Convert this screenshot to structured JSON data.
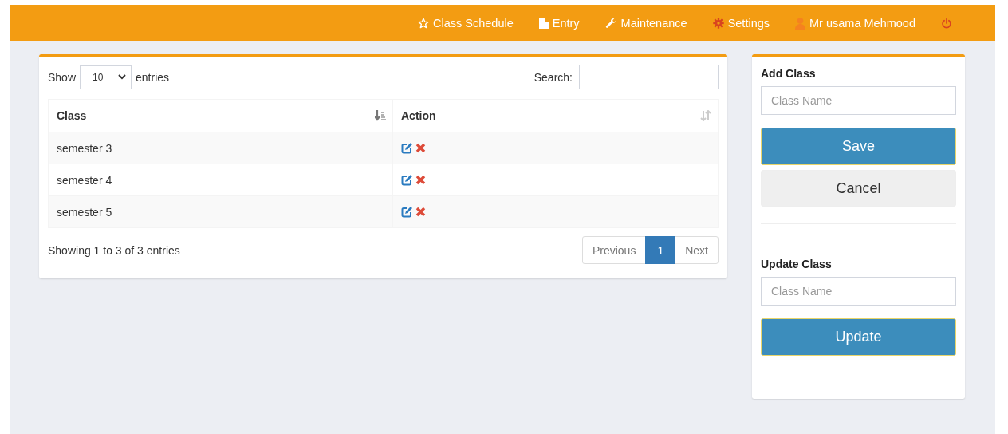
{
  "navbar": {
    "items": [
      {
        "kind": "star",
        "label": "Class Schedule"
      },
      {
        "kind": "file",
        "label": "Entry"
      },
      {
        "kind": "wrench",
        "label": "Maintenance"
      },
      {
        "kind": "gear",
        "label": "Settings"
      },
      {
        "kind": "user",
        "label": "Mr usama Mehmood"
      },
      {
        "kind": "power"
      }
    ]
  },
  "table_card": {
    "length_label_before": "Show",
    "length_value": "10",
    "length_label_after": "entries",
    "search_label": "Search:",
    "columns": [
      {
        "label": "Class",
        "sorted": true
      },
      {
        "label": "Action",
        "sorted": false
      }
    ],
    "rows": [
      {
        "class": "semester 3"
      },
      {
        "class": "semester 4"
      },
      {
        "class": "semester 5"
      }
    ],
    "info": "Showing 1 to 3 of 3 entries",
    "pagination": {
      "previous": "Previous",
      "pages": [
        {
          "label": "1",
          "selected": true
        }
      ],
      "next": "Next"
    }
  },
  "add_class": {
    "title": "Add Class",
    "placeholder": "Class Name",
    "save": "Save",
    "cancel": "Cancel"
  },
  "update_class": {
    "title": "Update Class",
    "placeholder": "Class Name",
    "update": "Update"
  }
}
